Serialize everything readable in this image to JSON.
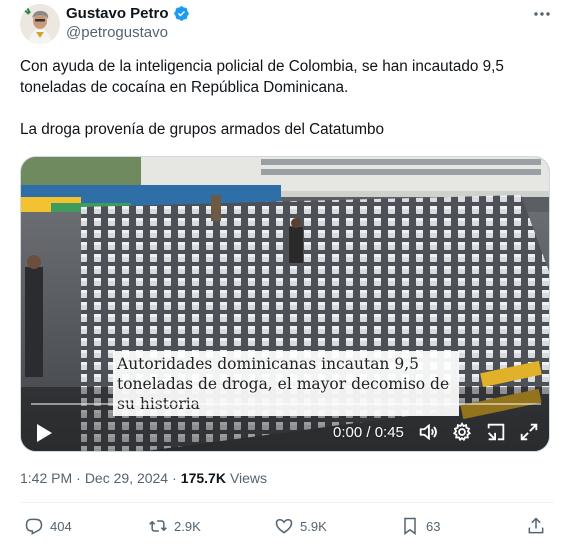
{
  "author": {
    "display_name": "Gustavo Petro",
    "handle": "@petrogustavo",
    "verified_color": "#1d9bf0"
  },
  "tweet": {
    "paragraphs": [
      "Con ayuda de la inteligencia policial de Colombia, se han incautado 9,5 toneladas de cocaína en República Dominicana.",
      "La droga provenía de grupos armados del Catatumbo"
    ]
  },
  "video": {
    "caption": "Autoridades dominicanas incautan 9,5 toneladas de droga, el mayor decomiso de su historia",
    "time": "0:00 / 0:45",
    "progress": 0.0,
    "controls": [
      "play-icon",
      "volume-icon",
      "settings-icon",
      "minimize-icon",
      "fullscreen-icon"
    ]
  },
  "meta": {
    "time": "1:42 PM",
    "separator": "·",
    "date": "Dec 29, 2024",
    "views_count": "175.7K",
    "views_label": "Views"
  },
  "actions": {
    "replies": "404",
    "reposts": "2.9K",
    "likes": "5.9K",
    "bookmarks": "63"
  },
  "colors": {
    "text": "#0f1419",
    "secondary": "#536471",
    "accent": "#1d9bf0"
  }
}
